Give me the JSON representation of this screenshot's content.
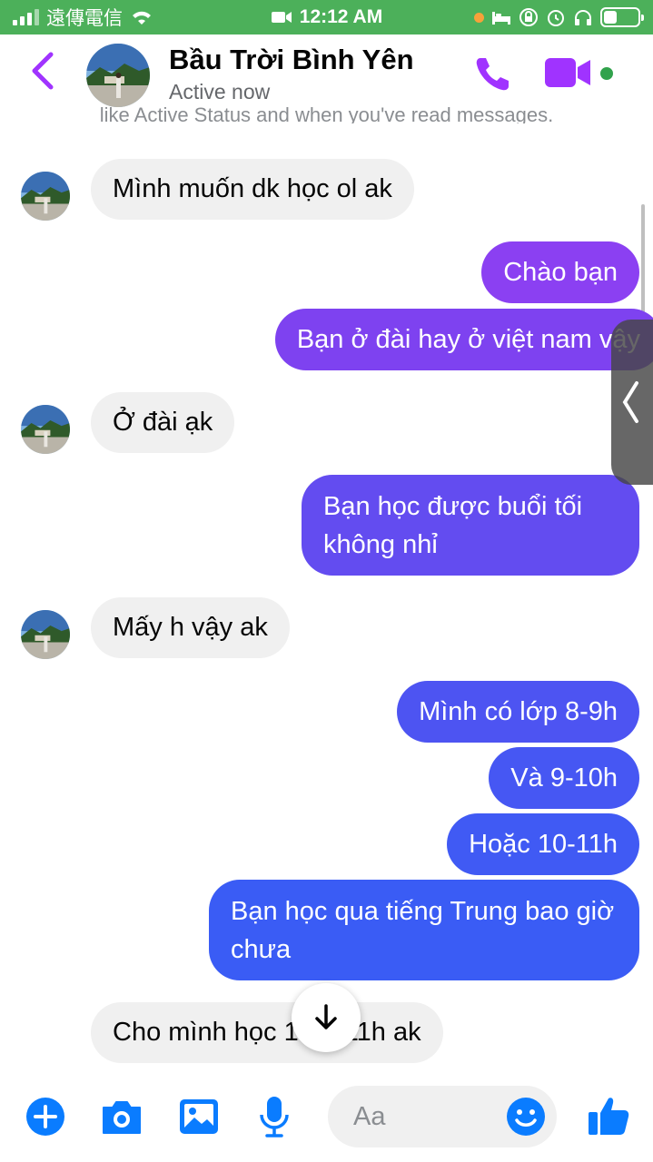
{
  "status_bar": {
    "carrier": "遠傳電信",
    "time": "12:12 AM"
  },
  "header": {
    "contact_name": "Bầu Trời Bình Yên",
    "status": "Active now"
  },
  "notice_text": "like Active Status and when you've read messages.",
  "messages": [
    {
      "dir": "in",
      "text": "Mình muốn dk học ol ak"
    },
    {
      "dir": "out",
      "text": "Chào bạn"
    },
    {
      "dir": "out",
      "text": "Bạn ở đài hay ở việt nam vậy"
    },
    {
      "dir": "in",
      "text": "Ở đài ạk"
    },
    {
      "dir": "out",
      "text": "Bạn học được buổi tối không nhỉ"
    },
    {
      "dir": "in",
      "text": "Mấy h vậy ak"
    },
    {
      "dir": "out",
      "text": "Mình có lớp 8-9h"
    },
    {
      "dir": "out",
      "text": "Và 9-10h"
    },
    {
      "dir": "out",
      "text": "Hoặc 10-11h"
    },
    {
      "dir": "out",
      "text": "Bạn học qua tiếng Trung bao giờ chưa"
    },
    {
      "dir": "in",
      "text": "Cho mình học 10h -11h ak"
    }
  ],
  "composer": {
    "placeholder": "Aa"
  },
  "icons": {
    "back": "chevron-left-icon",
    "call": "phone-icon",
    "video": "video-camera-icon",
    "plus": "plus-circle-icon",
    "camera": "camera-icon",
    "gallery": "image-icon",
    "mic": "microphone-icon",
    "emoji": "smile-icon",
    "like": "thumbs-up-icon",
    "scroll": "arrow-down-icon"
  },
  "colors": {
    "accent": "#a033ff",
    "out_top": "#8a3ff0",
    "out_mid": "#5a4ff0",
    "out_bottom": "#3a5cf5",
    "incoming": "#f0f0f0",
    "statusbar": "#4cb05a",
    "online": "#31a24c"
  }
}
